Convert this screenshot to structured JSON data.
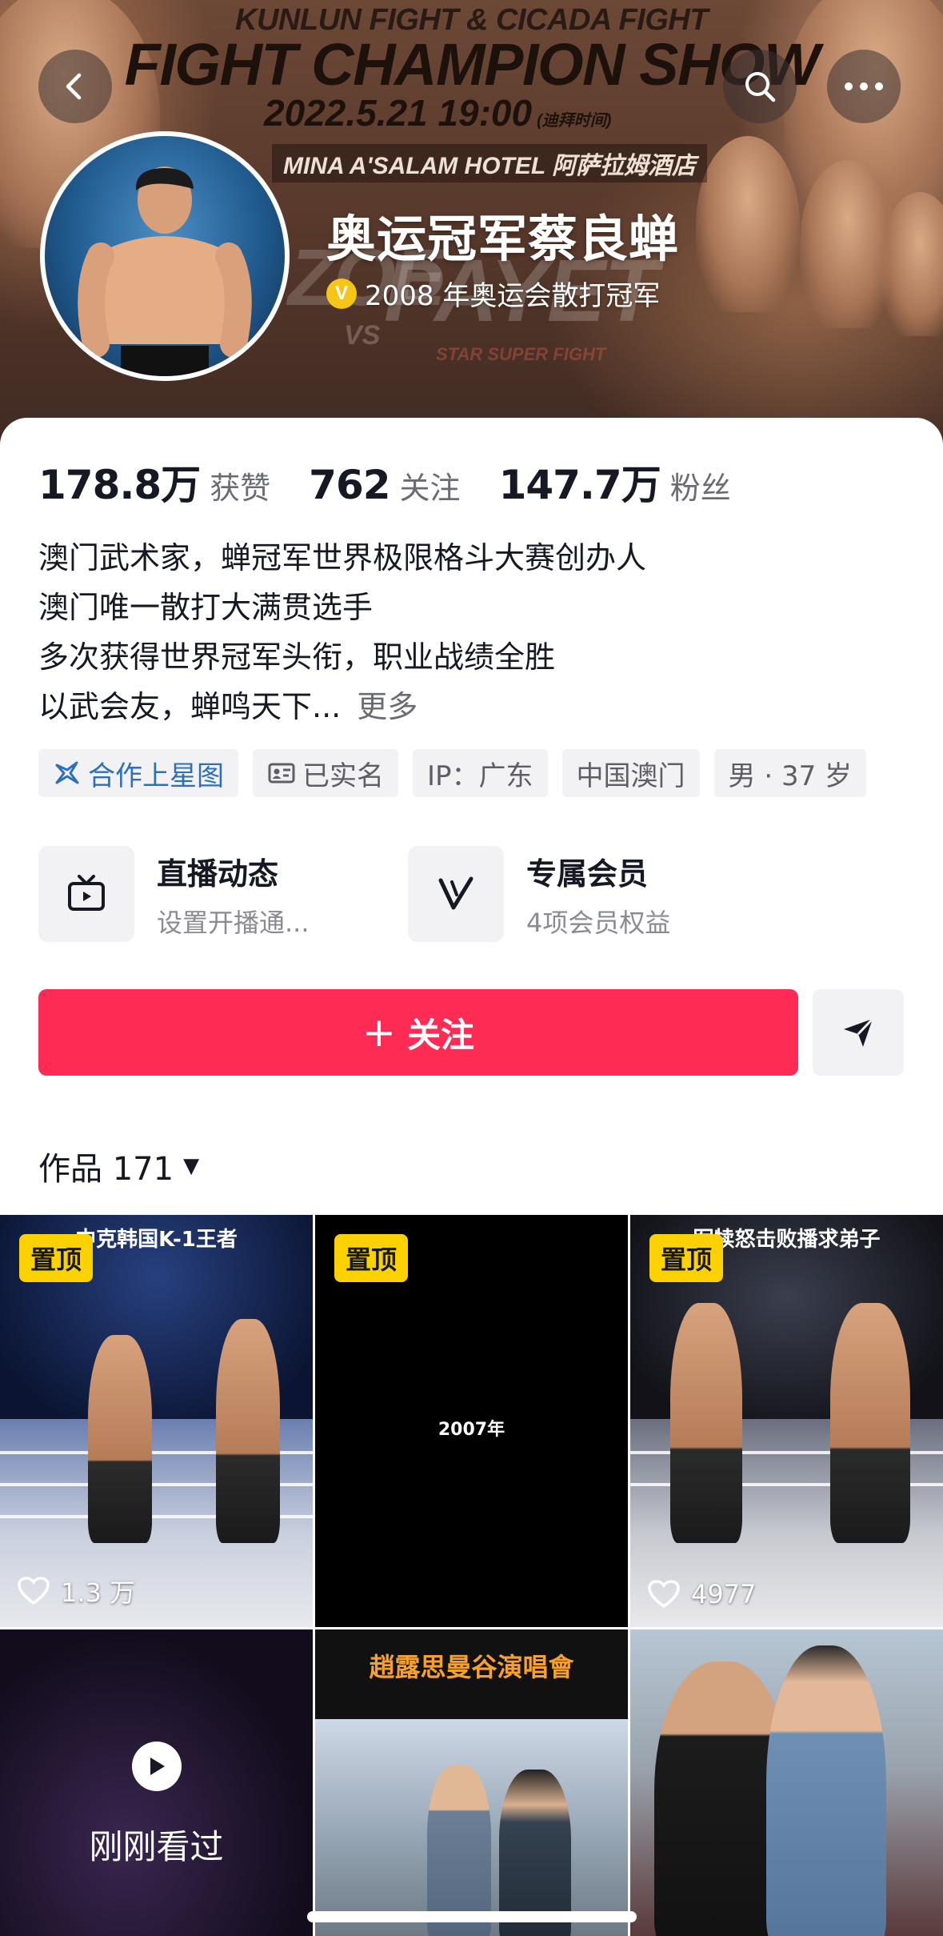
{
  "banner": {
    "title_line1": "KUNLUN FIGHT & CICADA FIGHT",
    "title_line2": "FIGHT CHAMPION SHOW",
    "date": "2022.5.21 19:00",
    "date_note": "(迪拜时间)",
    "hotel": "MINA A'SALAM HOTEL 阿萨拉姆酒店",
    "vs_left": "ZOE",
    "vs": "VS",
    "vs_right": "PAYET",
    "subfight": "STAR SUPER FIGHT"
  },
  "profile": {
    "name": "奥运冠军蔡良蝉",
    "verify_badge": "V",
    "verify_text": "2008 年奥运会散打冠军",
    "stats": [
      {
        "num": "178.8万",
        "label": "获赞"
      },
      {
        "num": "762",
        "label": "关注"
      },
      {
        "num": "147.7万",
        "label": "粉丝"
      }
    ],
    "bio": [
      "澳门武术家，蝉冠军世界极限格斗大赛创办人",
      "澳门唯一散打大满贯选手",
      "多次获得世界冠军头衔，职业战绩全胜",
      "以武会友，蝉鸣天下..."
    ],
    "bio_more": "更多",
    "tags": [
      "合作上星图",
      "已实名",
      "IP：广东",
      "中国澳门",
      "男 · 37 岁"
    ]
  },
  "services": [
    {
      "title": "直播动态",
      "sub": "设置开播通..."
    },
    {
      "title": "专属会员",
      "sub": "4项会员权益"
    }
  ],
  "actions": {
    "follow_plus": "+",
    "follow_label": "关注"
  },
  "works": {
    "label": "作品 171",
    "caret": "▼"
  },
  "grid": {
    "pin_label": "置顶",
    "cells": [
      {
        "headline": "中克韩国K-1王者",
        "likes": "1.3 万"
      },
      {
        "center_text": "2007年"
      },
      {
        "headline": "军犊怒击败播求弟子",
        "likes": "4977"
      },
      {
        "watched_label": "刚刚看过"
      },
      {
        "concert_title": "趙露思曼谷演唱會"
      },
      {}
    ]
  }
}
